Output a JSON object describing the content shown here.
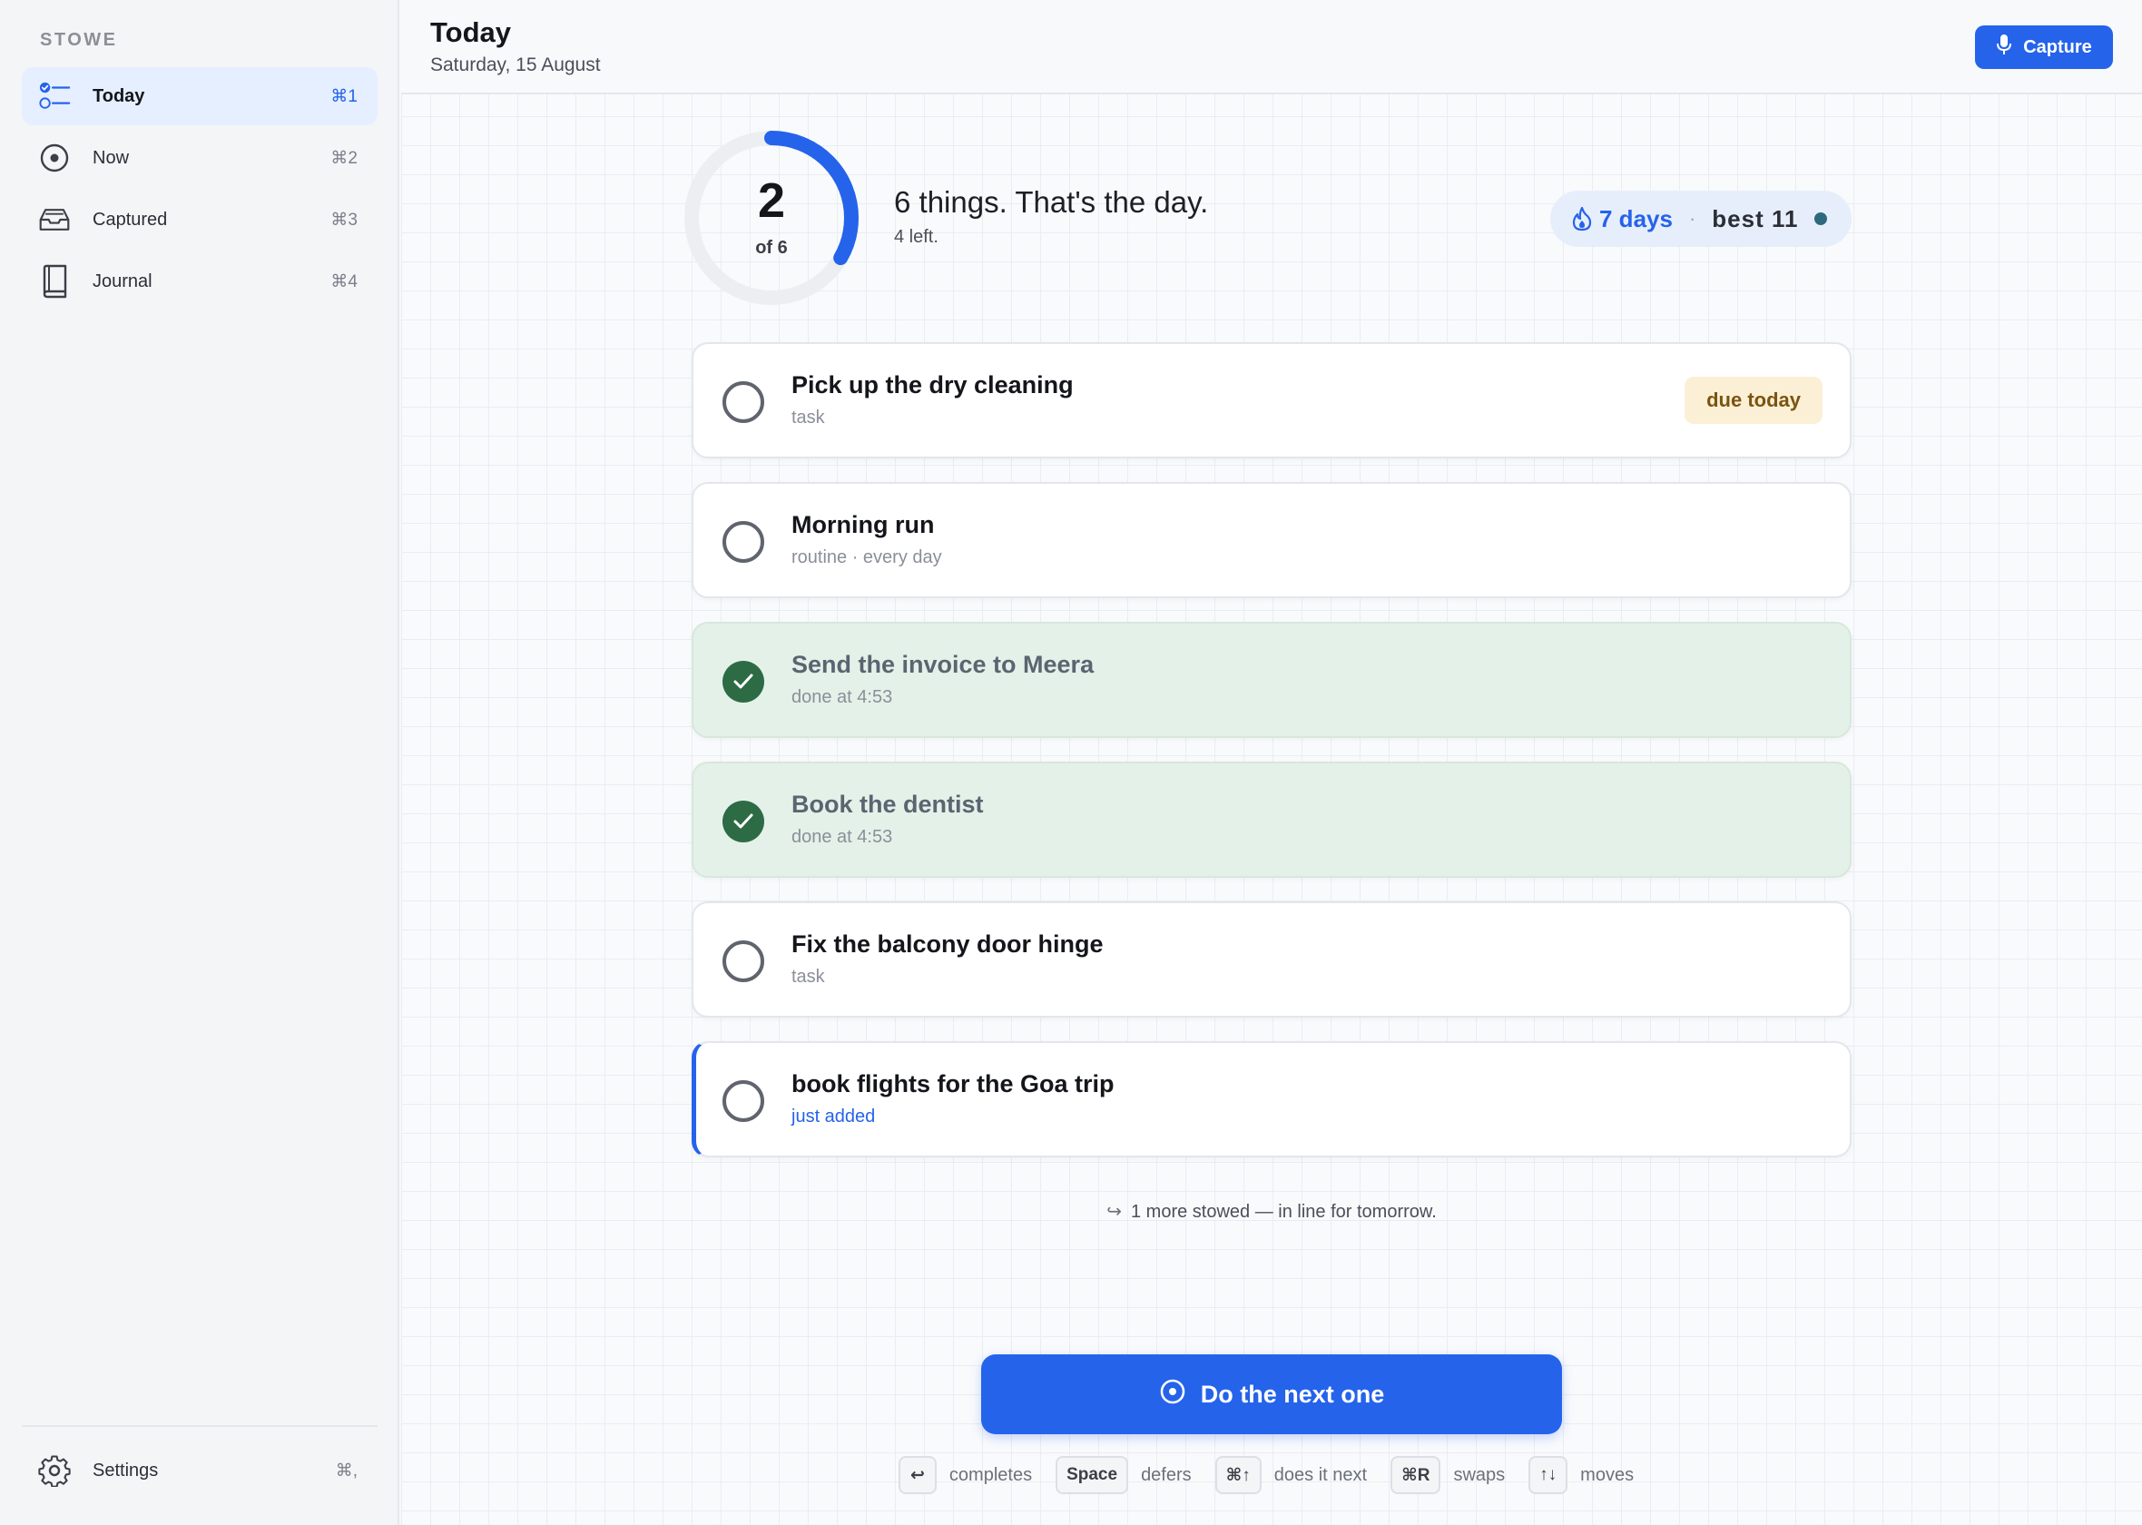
{
  "brand": "STOWE",
  "nav": {
    "items": [
      {
        "label": "Today",
        "shortcut": "⌘1"
      },
      {
        "label": "Now",
        "shortcut": "⌘2"
      },
      {
        "label": "Captured",
        "shortcut": "⌘3"
      },
      {
        "label": "Journal",
        "shortcut": "⌘4"
      }
    ],
    "settings": {
      "label": "Settings",
      "shortcut": "⌘,"
    }
  },
  "header": {
    "title": "Today",
    "date": "Saturday, 15 August",
    "capture_label": "Capture"
  },
  "progress": {
    "done": "2",
    "of_label": "of 6",
    "fraction": 0.3333,
    "headline": "6 things. That's the day.",
    "remaining": "4 left."
  },
  "streak": {
    "days": "7 days",
    "separator": "·",
    "best": "best 11"
  },
  "tasks": [
    {
      "title": "Pick up the dry cleaning",
      "meta": "task",
      "badge": "due today",
      "state": "open"
    },
    {
      "title": "Morning run",
      "meta": "routine · every day",
      "state": "open"
    },
    {
      "title": "Send the invoice to Meera",
      "meta": "done at 4:53",
      "state": "done"
    },
    {
      "title": "Book the dentist",
      "meta": "done at 4:53",
      "state": "done"
    },
    {
      "title": "Fix the balcony door hinge",
      "meta": "task",
      "state": "open"
    },
    {
      "title": "book flights for the Goa trip",
      "meta": "just added",
      "state": "new"
    }
  ],
  "stowed_note": "1 more stowed — in line for tomorrow.",
  "next_button": "Do the next one",
  "hints": [
    {
      "key": "↩",
      "text": "completes"
    },
    {
      "key": "Space",
      "text": "defers"
    },
    {
      "key": "⌘↑",
      "text": "does it next"
    },
    {
      "key": "⌘R",
      "text": "swaps"
    },
    {
      "key": "↑↓",
      "text": "moves"
    }
  ],
  "colors": {
    "accent": "#2563eb",
    "done_bg": "#e4f1e9",
    "done_check": "#2d6b45",
    "badge_bg": "#fbf0d6",
    "badge_text": "#7a5410"
  }
}
